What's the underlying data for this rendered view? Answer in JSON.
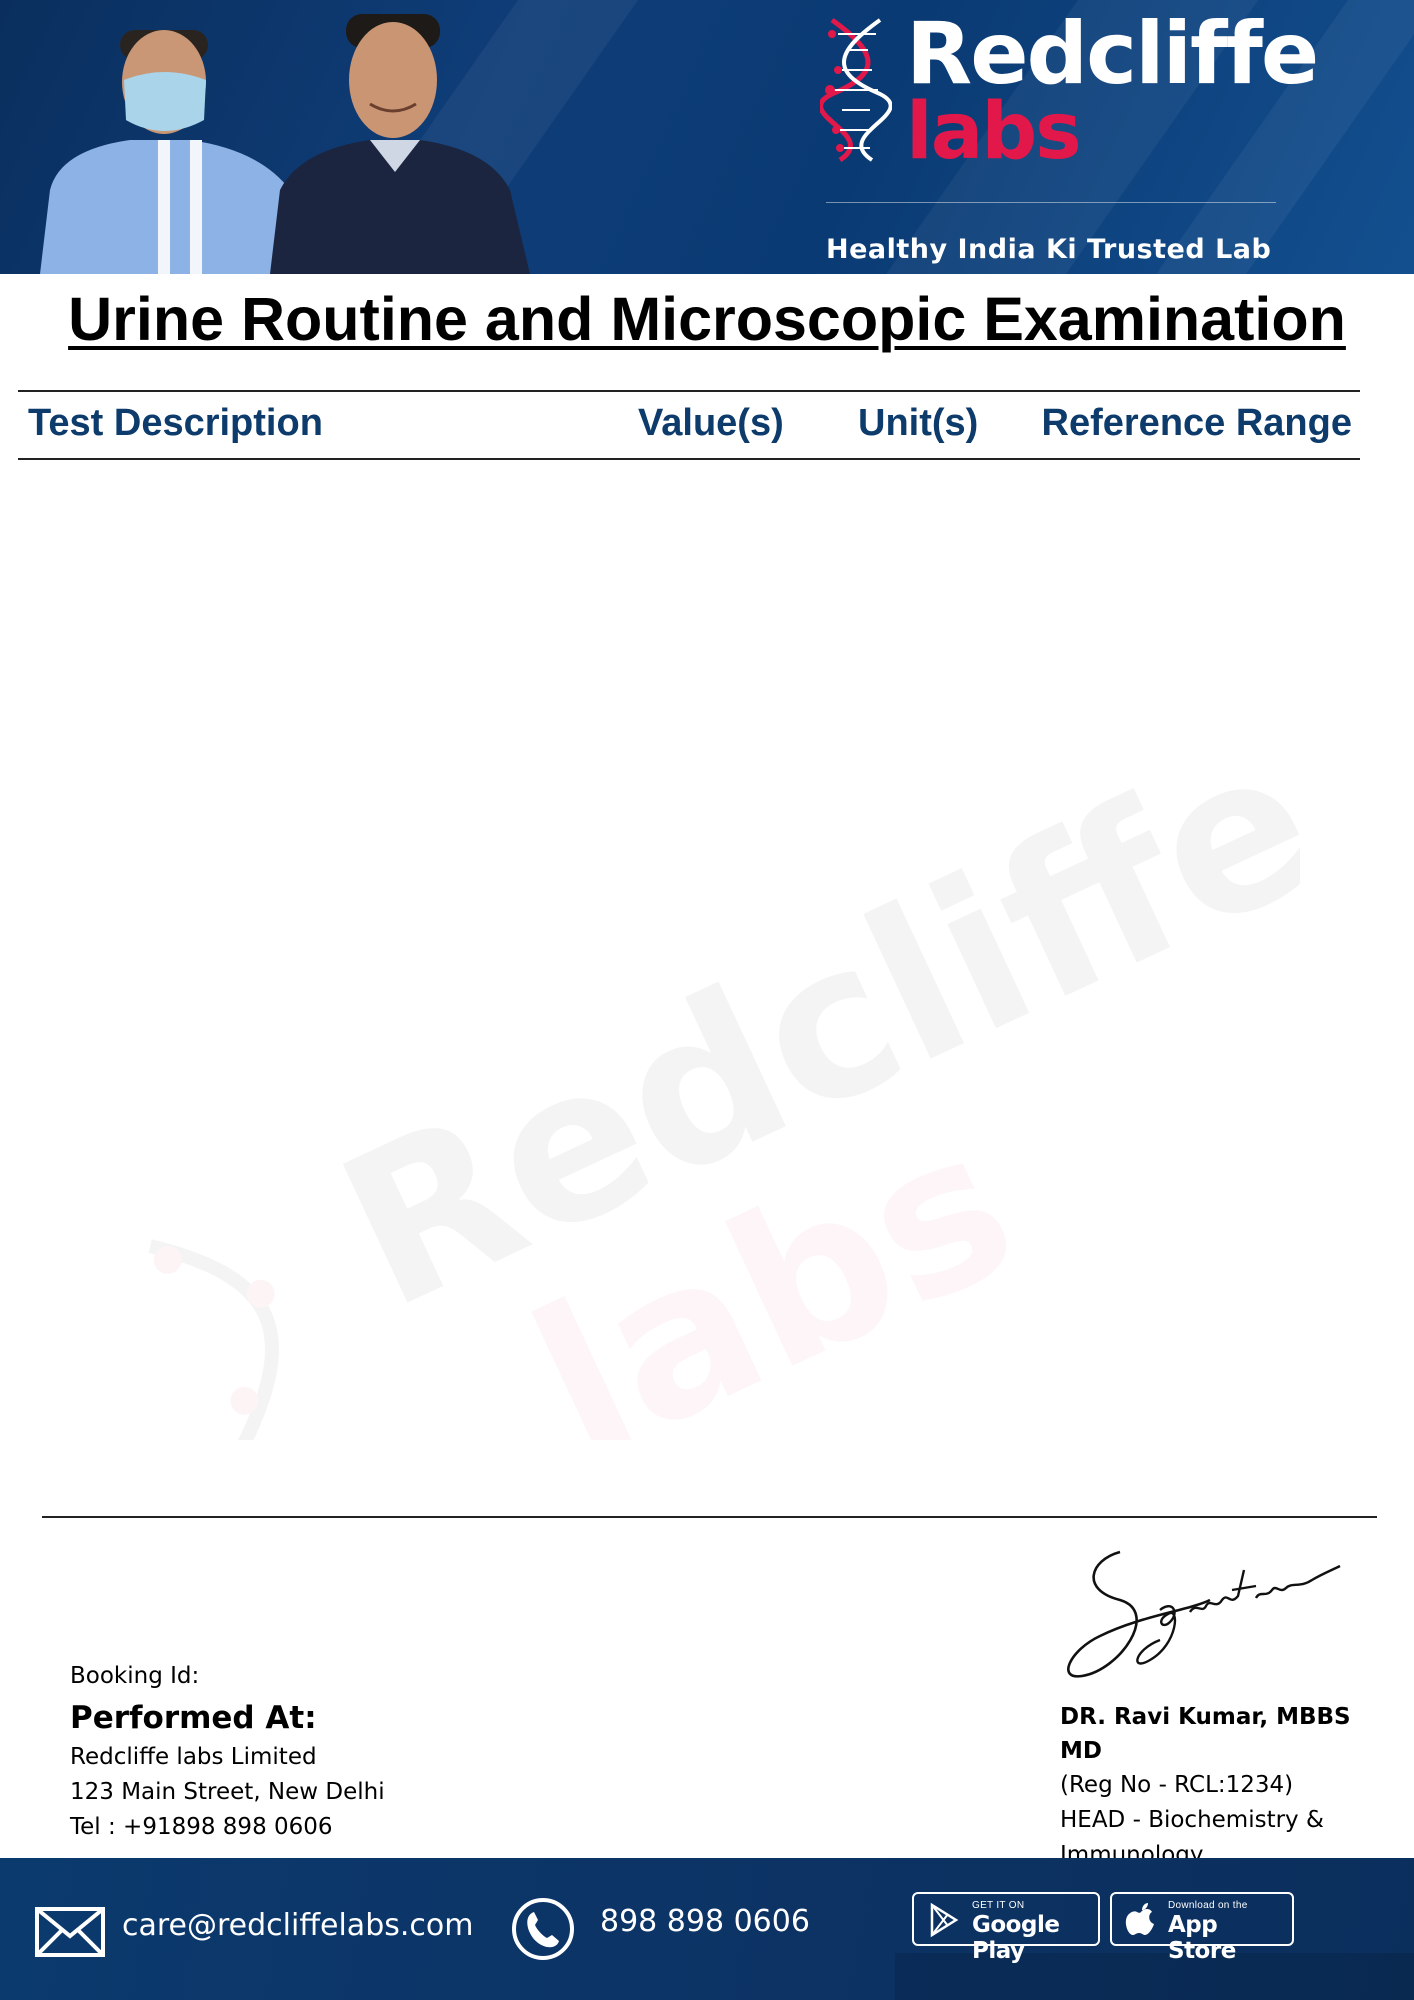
{
  "header": {
    "brand_line1": "Redcliffe",
    "brand_line2": "labs",
    "tagline": "Healthy India Ki Trusted Lab"
  },
  "report": {
    "title": "Urine Routine and Microscopic Examination",
    "columns": {
      "description": "Test Description",
      "values": "Value(s)",
      "units": "Unit(s)",
      "reference": "Reference Range"
    },
    "rows": []
  },
  "watermark": {
    "line1": "Redcliffe",
    "line2": "labs"
  },
  "lab_info": {
    "booking_label": "Booking Id:",
    "performed_at_label": "Performed At:",
    "lab_name": "Redcliffe labs Limited",
    "address": "123 Main Street, New Delhi",
    "tel": "Tel : +91898 898 0606"
  },
  "doctor": {
    "name": "DR. Ravi Kumar, MBBS MD",
    "reg": "(Reg No - RCL:1234)",
    "dept_line1": "HEAD - Biochemistry &",
    "dept_line2": "Immunology"
  },
  "footer": {
    "email": "care@redcliffelabs.com",
    "phone": "898 898 0606",
    "google_play_small": "GET IT ON",
    "google_play_big": "Google Play",
    "app_store_small": "Download on the",
    "app_store_big": "App Store"
  },
  "colors": {
    "brand_navy": "#0d3b6b",
    "brand_red": "#e2184a"
  }
}
